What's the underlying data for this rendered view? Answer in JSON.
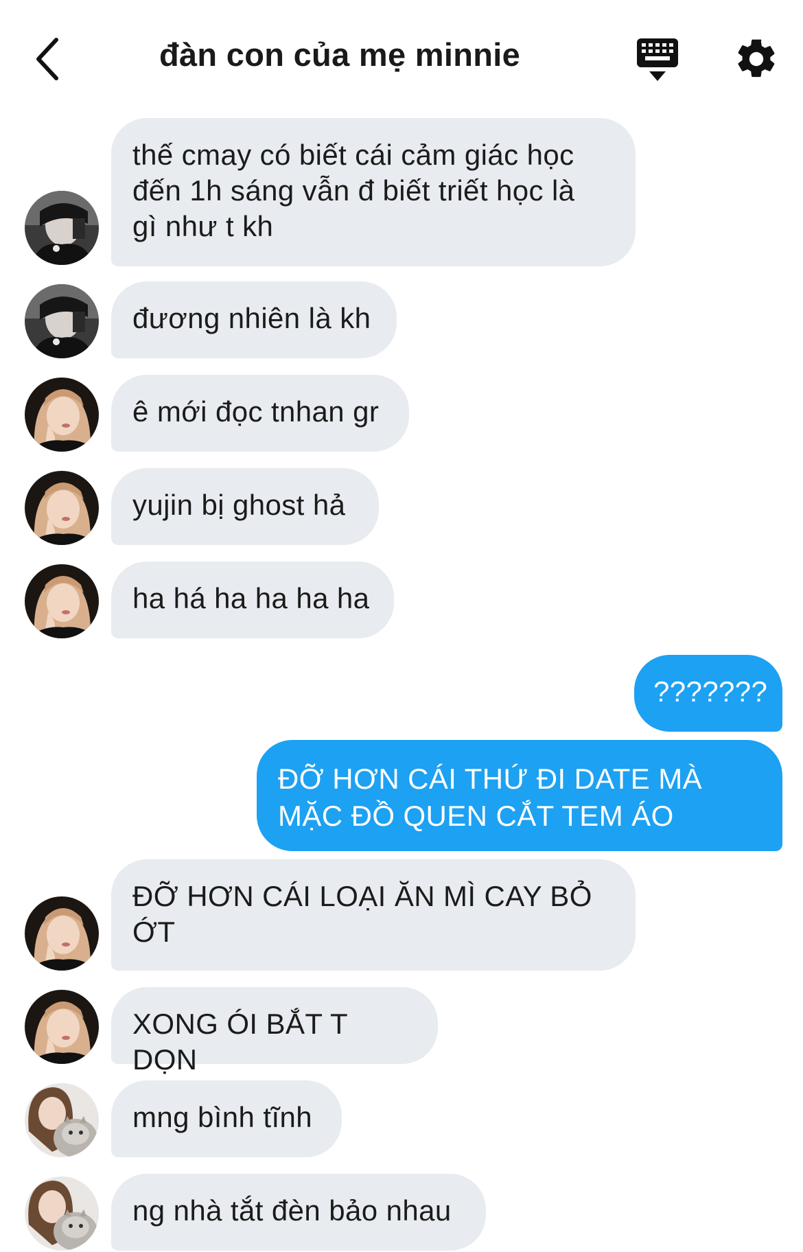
{
  "header": {
    "title": "đàn con của mẹ minnie",
    "back_icon": "chevron-left-icon",
    "keyboard_icon": "keyboard-icon",
    "settings_icon": "gear-icon"
  },
  "colors": {
    "incoming_bubble": "#e8ebef",
    "outgoing_bubble": "#1da1f2"
  },
  "messages": [
    {
      "sender": "friend-1",
      "text": "thế cmay có biết cái cảm giác học\nđến 1h sáng vẫn đ biết triết học là\ngì như t kh"
    },
    {
      "sender": "friend-1",
      "text": "đương nhiên là kh"
    },
    {
      "sender": "friend-2",
      "text": "ê mới đọc tnhan gr"
    },
    {
      "sender": "friend-2",
      "text": "yujin bị ghost hả"
    },
    {
      "sender": "friend-2",
      "text": "ha há ha ha ha ha"
    },
    {
      "sender": "me",
      "text": "???????"
    },
    {
      "sender": "me",
      "text": "ĐỠ HƠN CÁI THỨ ĐI DATE MÀ\nMẶC ĐỒ QUEN CẮT TEM ÁO"
    },
    {
      "sender": "friend-2",
      "text": "ĐỠ HƠN CÁI LOẠI ĂN MÌ CAY BỎ\nỚT"
    },
    {
      "sender": "friend-2",
      "text": "XONG ÓI BẮT T DỌN"
    },
    {
      "sender": "friend-3",
      "text": "mng bình tĩnh"
    },
    {
      "sender": "friend-3",
      "text": "ng nhà tắt đèn bảo nhau"
    }
  ]
}
